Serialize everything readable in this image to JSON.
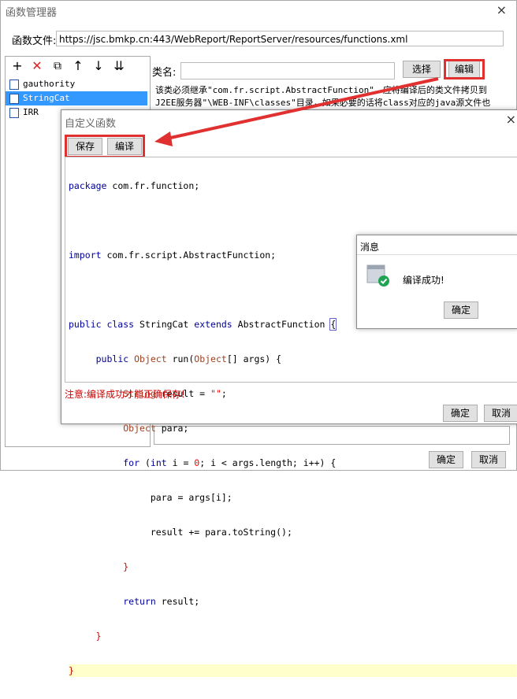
{
  "window": {
    "title": "函数管理器",
    "close": "×"
  },
  "function_file": {
    "label": "函数文件:",
    "value": "https://jsc.bmkp.cn:443/WebReport/ReportServer/resources/functions.xml"
  },
  "toolbar": {
    "add": "+",
    "delete": "✕",
    "copy": "⧉",
    "up": "↑",
    "down": "↓",
    "sort": "⇊"
  },
  "tree": {
    "items": [
      "gauthority",
      "StringCat",
      "IRR"
    ]
  },
  "class_name": {
    "label": "类名:",
    "select_label": "选择",
    "edit_label": "编辑"
  },
  "description": {
    "line1": "该类必须继承\"com.fr.script.AbstractFunction\"。应将编译后的类文件拷贝到",
    "line2": "J2EE服务器\"\\WEB-INF\\classes\"目录，如果必要的话将class对应的java源文件也"
  },
  "dialog": {
    "title": "自定义函数",
    "close": "×",
    "save_label": "保存",
    "compile_label": "编译",
    "hint": "注意:编译成功才能正确保存!",
    "ok_label": "确定",
    "cancel_label": "取消"
  },
  "code": {
    "lines": [
      "package com.fr.function;",
      "",
      "import com.fr.script.AbstractFunction;",
      "",
      "public class StringCat extends AbstractFunction {",
      "    public Object run(Object[] args) {",
      "        String result = \"\";",
      "        Object para;",
      "        for (int i = 0; i < args.length; i++) {",
      "            para = args[i];",
      "            result += para.toString();",
      "        }",
      "        return result;",
      "    }",
      "}"
    ]
  },
  "message": {
    "title": "消息",
    "text": "编译成功!",
    "ok_label": "确定"
  },
  "footer": {
    "ok_label": "确定",
    "cancel_label": "取消"
  },
  "colors": {
    "accent": "#3399ff",
    "annotation": "#e03030"
  }
}
